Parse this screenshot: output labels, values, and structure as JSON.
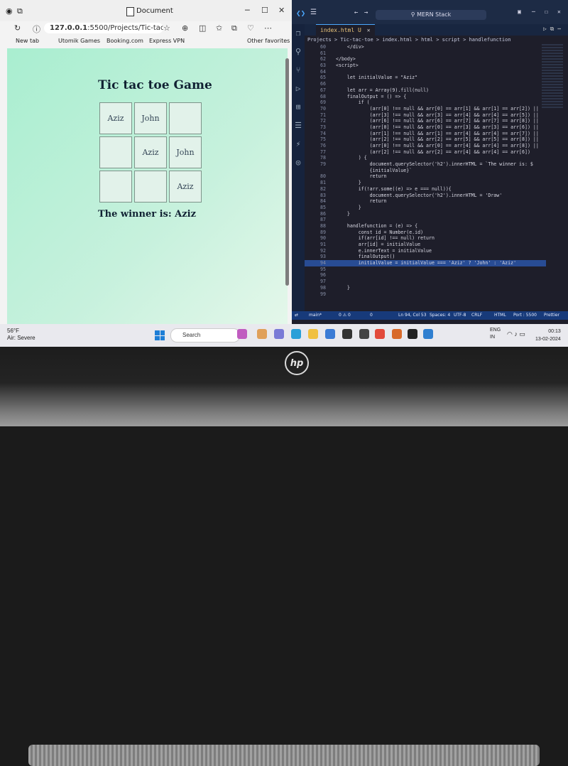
{
  "browser": {
    "tab_title": "Document",
    "url_host": "127.0.0.1",
    "url_rest": ":5500/Projects/Tic-tac-t...",
    "bookmarks": [
      "New tab",
      "Utomik Games",
      "Booking.com",
      "Express VPN"
    ],
    "other_favorites": "Other favorites"
  },
  "game": {
    "title": "Tic tac toe Game",
    "cells": [
      "Aziz",
      "John",
      "",
      "",
      "Aziz",
      "John",
      "",
      "",
      "Aziz"
    ],
    "winner": "The winner is: Aziz"
  },
  "vscode": {
    "command_center": "MERN Stack",
    "tab": "index.html U",
    "breadcrumb": "Projects > Tic-tac-toe > index.html > html > script > handlefunction",
    "code_lines": [
      {
        "n": "60",
        "t": "    </div>"
      },
      {
        "n": "61",
        "t": ""
      },
      {
        "n": "62",
        "t": "</body>"
      },
      {
        "n": "63",
        "t": "<script>"
      },
      {
        "n": "64",
        "t": ""
      },
      {
        "n": "65",
        "t": "    let initialValue = \"Aziz\""
      },
      {
        "n": "66",
        "t": ""
      },
      {
        "n": "67",
        "t": "    let arr = Array(9).fill(null)"
      },
      {
        "n": "68",
        "t": "    finalOutput = () => {"
      },
      {
        "n": "69",
        "t": "        if ("
      },
      {
        "n": "70",
        "t": "            (arr[0] !== null && arr[0] == arr[1] && arr[1] == arr[2]) ||"
      },
      {
        "n": "71",
        "t": "            (arr[3] !== null && arr[3] == arr[4] && arr[4] == arr[5]) ||"
      },
      {
        "n": "72",
        "t": "            (arr[6] !== null && arr[6] == arr[7] && arr[7] == arr[8]) ||"
      },
      {
        "n": "73",
        "t": "            (arr[0] !== null && arr[0] == arr[3] && arr[3] == arr[6]) ||"
      },
      {
        "n": "74",
        "t": "            (arr[1] !== null && arr[1] == arr[4] && arr[4] == arr[7]) ||"
      },
      {
        "n": "75",
        "t": "            (arr[2] !== null && arr[2] == arr[5] && arr[5] == arr[8]) ||"
      },
      {
        "n": "76",
        "t": "            (arr[0] !== null && arr[0] == arr[4] && arr[4] == arr[8]) ||"
      },
      {
        "n": "77",
        "t": "            (arr[2] !== null && arr[2] == arr[4] && arr[4] == arr[6])"
      },
      {
        "n": "78",
        "t": "        ) {"
      },
      {
        "n": "79",
        "t": "            document.querySelector('h2').innerHTML = `The winner is: $"
      },
      {
        "n": "",
        "t": "            {initialValue}`"
      },
      {
        "n": "80",
        "t": "            return"
      },
      {
        "n": "81",
        "t": "        }"
      },
      {
        "n": "82",
        "t": "        if(!arr.some((e) => e === null)){"
      },
      {
        "n": "83",
        "t": "            document.querySelector('h2').innerHTML = 'Draw'"
      },
      {
        "n": "84",
        "t": "            return"
      },
      {
        "n": "85",
        "t": "        }"
      },
      {
        "n": "86",
        "t": "    }"
      },
      {
        "n": "87",
        "t": ""
      },
      {
        "n": "88",
        "t": "    handlefunction = (e) => {"
      },
      {
        "n": "89",
        "t": "        const id = Number(e.id)"
      },
      {
        "n": "90",
        "t": "        if(arr[id] !== null) return"
      },
      {
        "n": "91",
        "t": "        arr[id] = initialValue"
      },
      {
        "n": "92",
        "t": "        e.innerText = initialValue"
      },
      {
        "n": "93",
        "t": "        finalOutput()"
      },
      {
        "n": "94",
        "t": "        initialValue = initialValue === 'Aziz' ? 'John' : 'Aziz'"
      },
      {
        "n": "95",
        "t": ""
      },
      {
        "n": "96",
        "t": ""
      },
      {
        "n": "97",
        "t": ""
      },
      {
        "n": "98",
        "t": "    }"
      },
      {
        "n": "99",
        "t": ""
      }
    ],
    "highlight_line": "94",
    "status": {
      "branch": "main*",
      "problems": "0 ⚠ 0",
      "port_info": "0",
      "position": "Ln 94, Col 53",
      "spaces": "Spaces: 4",
      "encoding": "UTF-8",
      "eol": "CRLF",
      "language": "HTML",
      "port": "Port : 5500",
      "prettier": "Prettier"
    }
  },
  "taskbar": {
    "temp": "56°F",
    "air": "Air: Severe",
    "search": "Search",
    "lang": "ENG",
    "lang2": "IN",
    "time": "00:13",
    "date": "13-02-2024"
  },
  "laptop": {
    "brand": "hp"
  },
  "colors": {
    "vscode_bg": "#1e1e2a",
    "highlight": "#284c94",
    "game_bg": "#b8f0d6",
    "status_bar": "#173a7a"
  }
}
